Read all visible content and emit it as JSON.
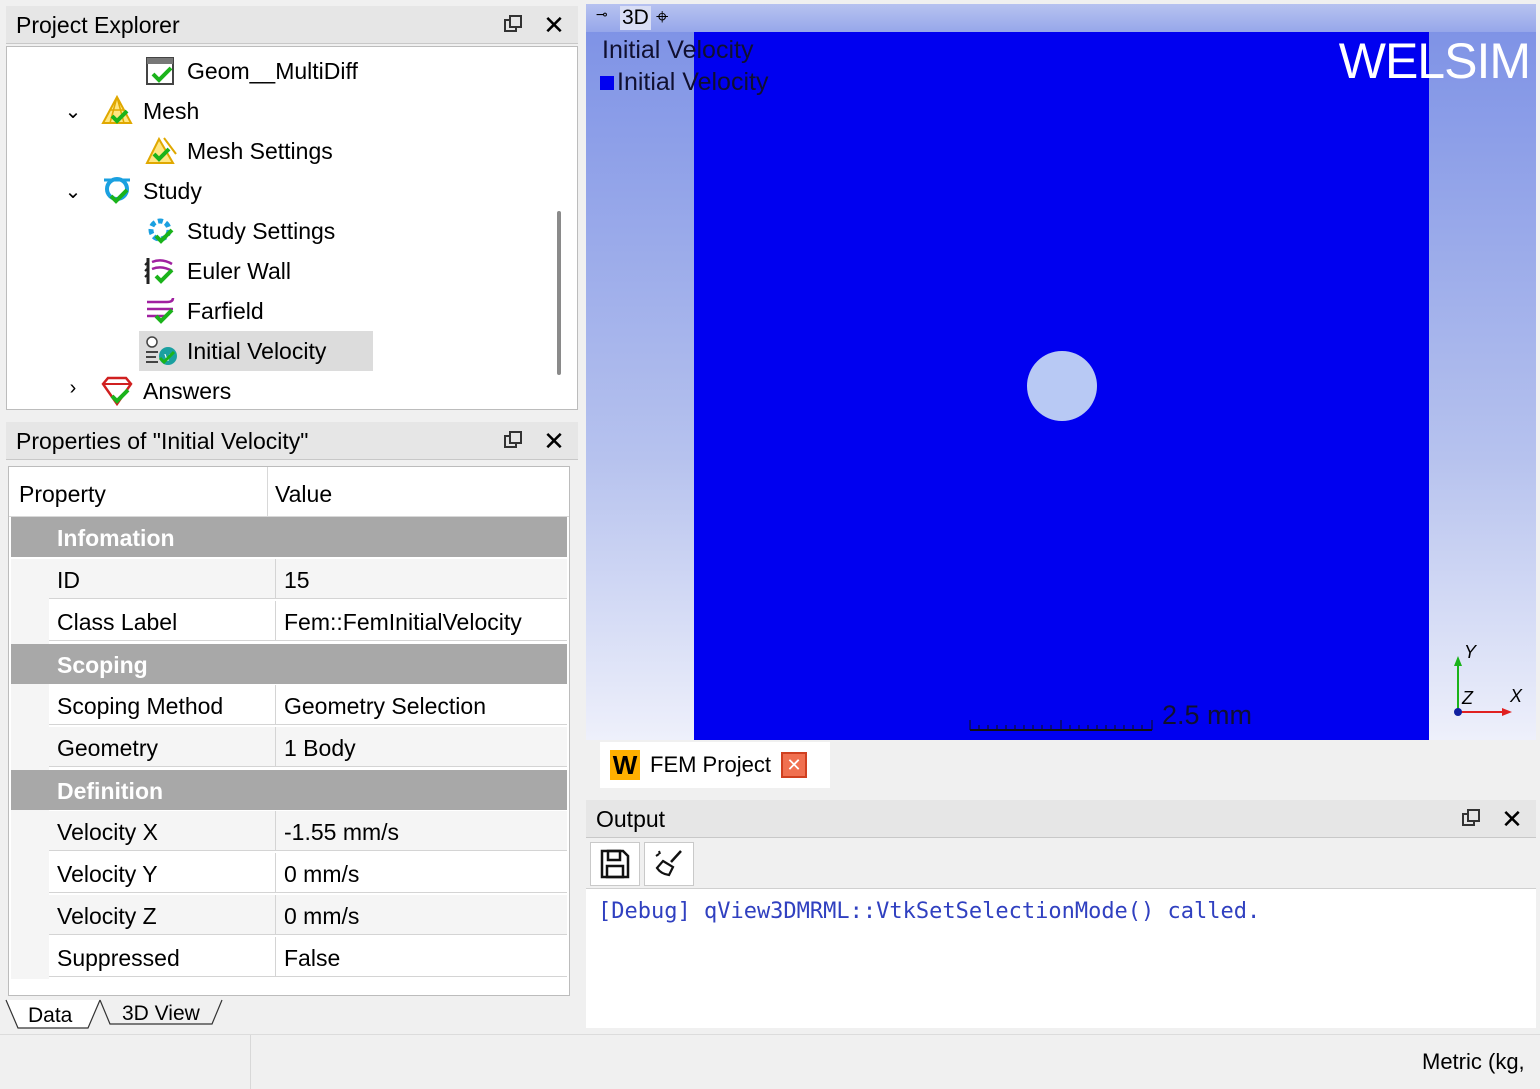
{
  "explorer": {
    "title": "Project Explorer",
    "items": [
      {
        "label": "Geom__MultiDiff",
        "icon": "geometry-check-icon"
      },
      {
        "label": "Mesh",
        "icon": "mesh-icon"
      },
      {
        "label": "Mesh Settings",
        "icon": "mesh-settings-icon"
      },
      {
        "label": "Study",
        "icon": "study-icon"
      },
      {
        "label": "Study Settings",
        "icon": "study-settings-icon"
      },
      {
        "label": "Euler Wall",
        "icon": "euler-wall-icon"
      },
      {
        "label": "Farfield",
        "icon": "farfield-icon"
      },
      {
        "label": "Initial Velocity",
        "icon": "initial-velocity-icon"
      },
      {
        "label": "Answers",
        "icon": "answers-icon"
      }
    ]
  },
  "properties": {
    "title": "Properties of \"Initial Velocity\"",
    "header": {
      "property": "Property",
      "value": "Value"
    },
    "groups": [
      {
        "name": "Infomation",
        "rows": [
          {
            "key": "ID",
            "value": "15"
          },
          {
            "key": "Class Label",
            "value": "Fem::FemInitialVelocity"
          }
        ]
      },
      {
        "name": "Scoping",
        "rows": [
          {
            "key": "Scoping Method",
            "value": "Geometry Selection"
          },
          {
            "key": "Geometry",
            "value": "1 Body"
          }
        ]
      },
      {
        "name": "Definition",
        "rows": [
          {
            "key": "Velocity X",
            "value": "-1.55 mm/s"
          },
          {
            "key": "Velocity Y",
            "value": "0 mm/s"
          },
          {
            "key": "Velocity Z",
            "value": "0 mm/s"
          },
          {
            "key": "Suppressed",
            "value": "False"
          }
        ]
      }
    ],
    "tabs": {
      "data": "Data",
      "view3d": "3D View"
    }
  },
  "view3d": {
    "toolbar_label": "3D",
    "title_text": "Initial Velocity",
    "legend_text": "Initial Velocity",
    "brand": "WELSIM",
    "scale_label": "2.5 mm",
    "axes": {
      "y": "Y",
      "z": "Z",
      "x": "X"
    },
    "colors": {
      "body": "#0000f0",
      "hole": "#b8c9f4"
    }
  },
  "doc_tab": {
    "label": "FEM Project",
    "logo": "W"
  },
  "output": {
    "title": "Output",
    "log": "[Debug] qView3DMRML::VtkSetSelectionMode() called."
  },
  "status": {
    "units": "Metric (kg,"
  }
}
